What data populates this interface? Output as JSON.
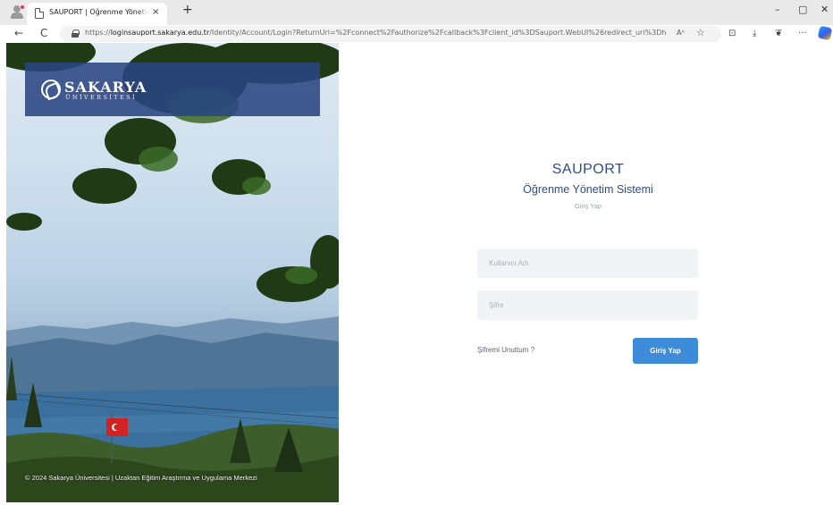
{
  "browser": {
    "tab_title": "SAUPORT | Öğrenme Yönetim Sist",
    "tab_close": "×",
    "new_tab": "+",
    "window": {
      "minimize": "–",
      "maximize": "▢",
      "close": "✕"
    },
    "nav": {
      "back": "←",
      "refresh": "C"
    },
    "url_prefix": "https://",
    "url_domain": "loginsauport.sakarya.edu.tr",
    "url_path": "/Identity/Account/Login?ReturnUrl=%2Fconnect%2Fauthorize%2Fcallback%3Fclient_id%3DSauport.WebUI%26redirect_uri%3Dhttps%...",
    "read_aloud": "Aᴬ",
    "favorite": "☆",
    "icons": {
      "split_screen": "⊡",
      "downloads": "⤓",
      "extensions": "❦",
      "more": "···"
    }
  },
  "hero": {
    "logo_name": "SAKARYA",
    "logo_sub": "ÜNİVERSİTESİ",
    "footer": "© 2024 Sakarya Üniversitesi | Uzaktan Eğitim Araştırma ve Uygulama Merkezi"
  },
  "login": {
    "brand": "SAUPORT",
    "subtitle": "Öğrenme Yönetim Sistemi",
    "hint": "Giriş Yap",
    "username_placeholder": "Kullanıcı Adı",
    "password_placeholder": "Şifre",
    "forgot_label": "Şifremi Unuttum ?",
    "submit_label": "Giriş Yap"
  },
  "colors": {
    "brand": "#2c4d8a",
    "button": "#3d8bd9",
    "field_bg": "#f1f3f7",
    "logo_box": "#2a4682"
  }
}
